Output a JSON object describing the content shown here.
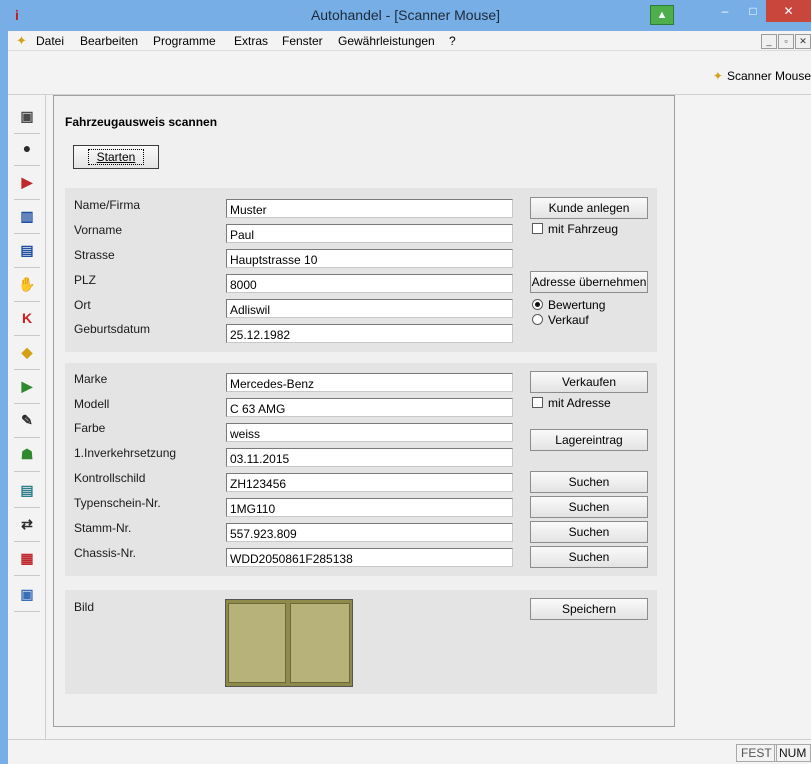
{
  "window": {
    "title": "Autohandel - [Scanner Mouse]",
    "app_icon": "i",
    "minimize_glyph": "–",
    "maximize_glyph": "□",
    "close_glyph": "✕"
  },
  "menu": {
    "items": [
      "Datei",
      "Bearbeiten",
      "Programme",
      "Extras",
      "Fenster",
      "Gewährleistungen",
      "?"
    ],
    "mdi_controls": [
      "_",
      "▫",
      "✕"
    ]
  },
  "toolbar": {
    "scanner_mouse_label": "Scanner Mouse"
  },
  "left_toolbar": {
    "icons": [
      {
        "name": "computer-icon",
        "glyph": "▣",
        "color": "#4a4a4a"
      },
      {
        "name": "person-icon",
        "glyph": "●",
        "color": "#2b2b2b"
      },
      {
        "name": "car-icon",
        "glyph": "▶",
        "color": "#c0282d"
      },
      {
        "name": "bar-chart-icon",
        "glyph": "▥",
        "color": "#1f4fa3"
      },
      {
        "name": "calendar-icon",
        "glyph": "▤",
        "color": "#1f4fa3"
      },
      {
        "name": "handshake-icon",
        "glyph": "✋",
        "color": "#3b6fb6"
      },
      {
        "name": "k-icon",
        "glyph": "K",
        "color": "#d01e1e"
      },
      {
        "name": "tag-icon",
        "glyph": "◆",
        "color": "#d4a017"
      },
      {
        "name": "car-sale-icon",
        "glyph": "▶",
        "color": "#2f8a2f"
      },
      {
        "name": "edit-icon",
        "glyph": "✎",
        "color": "#2b2b2b"
      },
      {
        "name": "people-icon",
        "glyph": "☗",
        "color": "#2f8a2f"
      },
      {
        "name": "document-icon",
        "glyph": "▤",
        "color": "#2f7f8a"
      },
      {
        "name": "transfer-icon",
        "glyph": "⇄",
        "color": "#2b2b2b"
      },
      {
        "name": "report-icon",
        "glyph": "▦",
        "color": "#c0282d"
      },
      {
        "name": "scanner-icon",
        "glyph": "▣",
        "color": "#3b6fb6"
      }
    ]
  },
  "form": {
    "title": "Fahrzeugausweis scannen",
    "start_button": "Starten",
    "person": {
      "fields": [
        {
          "label": "Name/Firma",
          "value": "Muster"
        },
        {
          "label": "Vorname",
          "value": "Paul"
        },
        {
          "label": "Strasse",
          "value": "Hauptstrasse 10"
        },
        {
          "label": "PLZ",
          "value": "8000"
        },
        {
          "label": "Ort",
          "value": "Adliswil"
        },
        {
          "label": "Geburtsdatum",
          "value": "25.12.1982"
        }
      ],
      "create_customer_button": "Kunde anlegen",
      "with_vehicle_checkbox": "mit Fahrzeug",
      "take_address_button": "Adresse übernehmen",
      "radio_evaluation": "Bewertung",
      "radio_sale": "Verkauf"
    },
    "vehicle": {
      "fields": [
        {
          "label": "Marke",
          "value": "Mercedes-Benz"
        },
        {
          "label": "Modell",
          "value": "C 63 AMG"
        },
        {
          "label": "Farbe",
          "value": "weiss"
        },
        {
          "label": "1.Inverkehrsetzung",
          "value": "03.11.2015"
        },
        {
          "label": "Kontrollschild",
          "value": "ZH123456"
        },
        {
          "label": "Typenschein-Nr.",
          "value": "1MG110"
        },
        {
          "label": "Stamm-Nr.",
          "value": "557.923.809"
        },
        {
          "label": "Chassis-Nr.",
          "value": "WDD2050861F285138"
        }
      ],
      "sell_button": "Verkaufen",
      "with_address_checkbox": "mit Adresse",
      "stock_entry_button": "Lagereintrag",
      "search_button": "Suchen"
    },
    "image": {
      "label": "Bild",
      "save_button": "Speichern"
    }
  },
  "statusbar": {
    "fest": "FEST",
    "num": "NUM"
  }
}
